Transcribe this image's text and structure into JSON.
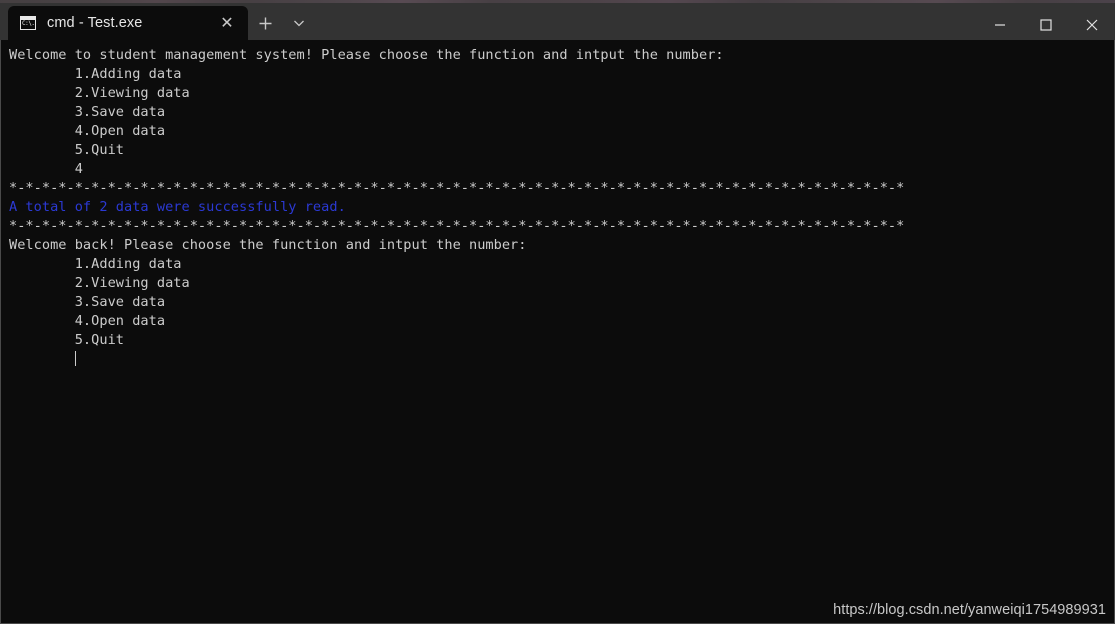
{
  "window": {
    "app": "Windows Terminal",
    "tabs": [
      {
        "title": "cmd - Test.exe",
        "icon": "cmd-icon",
        "prompt_glyph": "C:\\.",
        "close_label": "✕",
        "active": true
      }
    ],
    "new_tab_label": "+",
    "tab_dropdown_label": "⌄",
    "controls": {
      "minimize": "—",
      "maximize": "☐",
      "close": "✕"
    }
  },
  "terminal": {
    "background": "#0c0c0c",
    "foreground": "#cccccc",
    "accent_blue": "#2b39d4",
    "cursor": "|",
    "lines": [
      {
        "text": "Welcome to student management system! Please choose the function and intput the number:",
        "color": "default"
      },
      {
        "text": "        1.Adding data",
        "color": "default"
      },
      {
        "text": "        2.Viewing data",
        "color": "default"
      },
      {
        "text": "        3.Save data",
        "color": "default"
      },
      {
        "text": "        4.Open data",
        "color": "default"
      },
      {
        "text": "        5.Quit",
        "color": "default"
      },
      {
        "text": "        4",
        "color": "default"
      },
      {
        "text": "*-*-*-*-*-*-*-*-*-*-*-*-*-*-*-*-*-*-*-*-*-*-*-*-*-*-*-*-*-*-*-*-*-*-*-*-*-*-*-*-*-*-*-*-*-*-*-*-*-*-*-*-*-*-*",
        "color": "default"
      },
      {
        "text": "A total of 2 data were successfully read.",
        "color": "blue"
      },
      {
        "text": "*-*-*-*-*-*-*-*-*-*-*-*-*-*-*-*-*-*-*-*-*-*-*-*-*-*-*-*-*-*-*-*-*-*-*-*-*-*-*-*-*-*-*-*-*-*-*-*-*-*-*-*-*-*-*",
        "color": "default"
      },
      {
        "text": "Welcome back! Please choose the function and intput the number:",
        "color": "default"
      },
      {
        "text": "        1.Adding data",
        "color": "default"
      },
      {
        "text": "        2.Viewing data",
        "color": "default"
      },
      {
        "text": "        3.Save data",
        "color": "default"
      },
      {
        "text": "        4.Open data",
        "color": "default"
      },
      {
        "text": "        5.Quit",
        "color": "default"
      }
    ],
    "cursor_line_indent": "        "
  },
  "watermark": {
    "text": "https://blog.csdn.net/yanweiqi1754989931"
  }
}
